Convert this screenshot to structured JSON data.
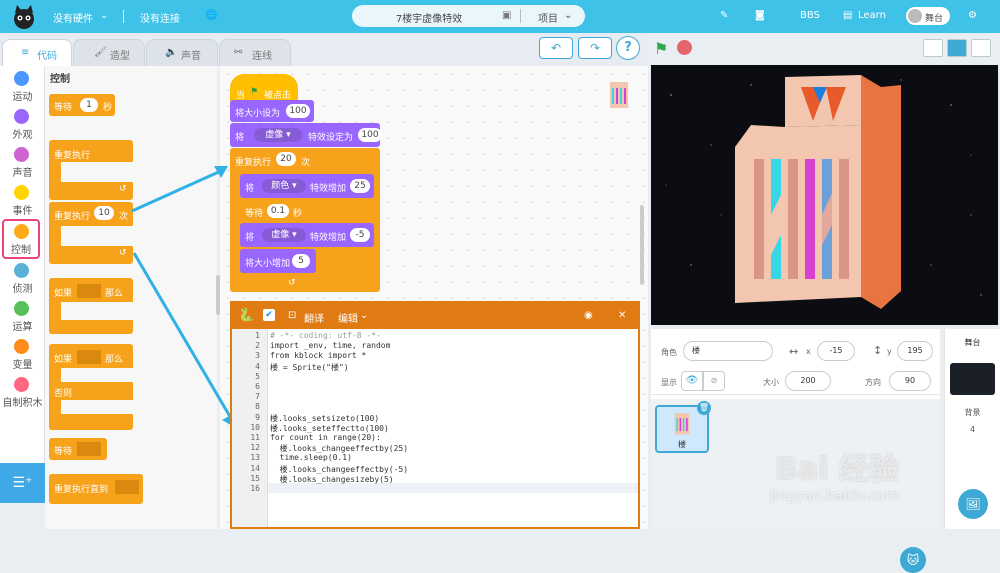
{
  "topbar": {
    "hardware": "没有硬件",
    "connection": "没有连接",
    "project_name": "7楼宇虚像特效",
    "project_menu": "项目",
    "bbs": "BBS",
    "learn": "Learn",
    "stage_toggle": "舞台"
  },
  "tabs": [
    {
      "label": "代码",
      "active": true
    },
    {
      "label": "造型",
      "active": false
    },
    {
      "label": "声音",
      "active": false
    },
    {
      "label": "连线",
      "active": false
    }
  ],
  "help_label": "?",
  "categories": [
    {
      "label": "运动",
      "color": "#4c97ff"
    },
    {
      "label": "外观",
      "color": "#9966ff"
    },
    {
      "label": "声音",
      "color": "#cf63cf"
    },
    {
      "label": "事件",
      "color": "#ffd500"
    },
    {
      "label": "控制",
      "color": "#ffab19",
      "selected": true
    },
    {
      "label": "侦测",
      "color": "#5cb1d6"
    },
    {
      "label": "运算",
      "color": "#59c059"
    },
    {
      "label": "变量",
      "color": "#ff8c1a"
    },
    {
      "label": "自制积木",
      "color": "#ff6680"
    }
  ],
  "palette": {
    "title": "控制",
    "wait": "等待",
    "wait_val": "1",
    "sec": "秒",
    "forever": "重复执行",
    "repeat": "重复执行",
    "repeat_val": "10",
    "times": "次",
    "if": "如果",
    "then": "那么",
    "if2": "如果",
    "then2": "那么",
    "else": "否则",
    "wait_until": "等待",
    "repeat_until": "重复执行直到"
  },
  "script": {
    "hat_when": "当",
    "hat_clicked": "被点击",
    "set_size": "将大小设为",
    "set_size_val": "100",
    "set_eff_pre": "将",
    "set_eff_drop": "虚像",
    "set_eff_mid": "特效设定为",
    "set_eff_val": "100",
    "repeat": "重复执行",
    "repeat_val": "20",
    "repeat_times": "次",
    "chg1_pre": "将",
    "chg1_drop": "颜色",
    "chg1_mid": "特效增加",
    "chg1_val": "25",
    "wait": "等待",
    "wait_val": "0.1",
    "wait_sec": "秒",
    "chg2_pre": "将",
    "chg2_drop": "虚像",
    "chg2_mid": "特效增加",
    "chg2_val": "-5",
    "chg_size": "将大小增加",
    "chg_size_val": "5"
  },
  "python": {
    "translate": "翻译",
    "edit": "编辑",
    "lines": [
      {
        "n": "1",
        "code": "# -*- coding: utf-8 -*-",
        "color": "#999999"
      },
      {
        "n": "2",
        "code": "import _env, time, random",
        "color": "#333333"
      },
      {
        "n": "3",
        "code": "from kblock import *",
        "color": "#333333"
      },
      {
        "n": "4",
        "code": "楼 = Sprite(\"楼\")",
        "color": "#333333"
      },
      {
        "n": "5",
        "code": "",
        "color": "#333333"
      },
      {
        "n": "6",
        "code": "",
        "color": "#333333"
      },
      {
        "n": "7",
        "code": "",
        "color": "#333333"
      },
      {
        "n": "8",
        "code": "",
        "color": "#333333"
      },
      {
        "n": "9",
        "code": "楼.looks_setsizeto(100)",
        "color": "#333333"
      },
      {
        "n": "10",
        "code": "楼.looks_seteffectto(100)",
        "color": "#333333"
      },
      {
        "n": "11",
        "code": "for count in range(20):",
        "color": "#333333"
      },
      {
        "n": "12",
        "code": "  楼.looks_changeeffectby(25)",
        "color": "#333333"
      },
      {
        "n": "13",
        "code": "  time.sleep(0.1)",
        "color": "#333333"
      },
      {
        "n": "14",
        "code": "  楼.looks_changeeffectby(-5)",
        "color": "#333333"
      },
      {
        "n": "15",
        "code": "  楼.looks_changesizeby(5)",
        "color": "#333333"
      },
      {
        "n": "16",
        "code": "",
        "color": "#333333"
      }
    ]
  },
  "sprite": {
    "role_label": "角色",
    "role_name": "楼",
    "x_label": "x",
    "x_val": "-15",
    "y_label": "y",
    "y_val": "195",
    "show_label": "显示",
    "size_label": "大小",
    "size_val": "200",
    "dir_label": "方向",
    "dir_val": "90",
    "tile_name": "楼"
  },
  "stage_panel": {
    "title": "舞台",
    "backdrop_label": "背景",
    "backdrop_count": "4"
  },
  "watermark": {
    "brand": "Bai 经验",
    "url": "jingyan.baidu.com"
  },
  "colors": {
    "accent": "#3fc2e8",
    "control": "#f7a21b",
    "looks": "#9966ff",
    "event": "#ffbf00",
    "python_header": "#e07a12"
  }
}
